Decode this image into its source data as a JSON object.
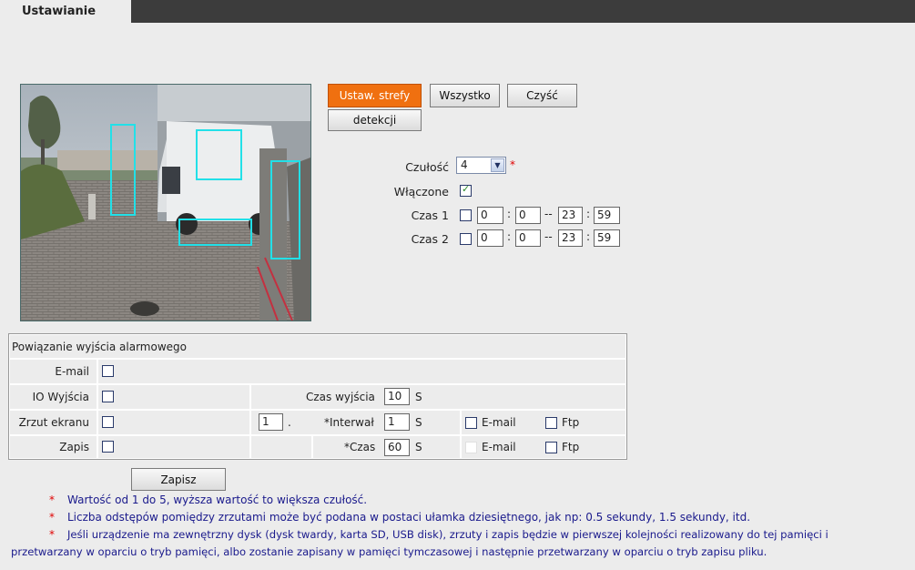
{
  "tab": {
    "title": "Ustawianie"
  },
  "zone_buttons": {
    "set_zone": "Ustaw. strefy",
    "detection": "detekcji",
    "all": "Wszystko",
    "clear": "Czyść"
  },
  "settings": {
    "sensitivity_label": "Czułość",
    "sensitivity_value": "4",
    "sensitivity_star": "*",
    "enabled_label": "Włączone",
    "enabled_checked": true,
    "time1": {
      "label": "Czas 1",
      "checked": false,
      "h1": "0",
      "m1": "0",
      "h2": "23",
      "m2": "59"
    },
    "time2": {
      "label": "Czas 2",
      "checked": false,
      "h1": "0",
      "m1": "0",
      "h2": "23",
      "m2": "59"
    },
    "colon": ":",
    "dash": "--"
  },
  "alarm": {
    "header": "Powiązanie wyjścia alarmowego",
    "email_label": "E-mail",
    "io_label": "IO Wyjścia",
    "out_time_label": "Czas wyjścia",
    "out_time_value": "10",
    "out_time_unit": "S",
    "snapshot_label": "Zrzut ekranu",
    "snapshot_count": "1",
    "snapshot_dot": ".",
    "interval_label": "*Interwał",
    "interval_value": "1",
    "interval_unit": "S",
    "snap_email": "E-mail",
    "snap_ftp": "Ftp",
    "record_label": "Zapis",
    "record_time_label": "*Czas",
    "record_time_value": "60",
    "record_time_unit": "S",
    "rec_email": "E-mail",
    "rec_ftp": "Ftp"
  },
  "save_button": "Zapisz",
  "notes": {
    "star": "*",
    "n1": "Wartość od 1 do 5, wyższa wartość to większa czułość.",
    "n2": "Liczba odstępów pomiędzy zrzutami może być podana w postaci ułamka dziesiętnego, jak np: 0.5 sekundy, 1.5 sekundy, itd.",
    "n3a": "Jeśli urządzenie ma zewnętrzny dysk (dysk twardy, karta SD, USB disk), zrzuty i zapis będzie w pierwszej kolejności realizowany do tej pamięci i",
    "n3b": "przetwarzany w oparciu o tryb pamięci, albo zostanie zapisany w pamięci tymczasowej i następnie przetwarzany w oparciu o tryb zapisu pliku."
  },
  "colors": {
    "accent": "#f07010",
    "zone": "#22e0e8",
    "note_text": "#1a1a8c",
    "required": "#e00000"
  }
}
